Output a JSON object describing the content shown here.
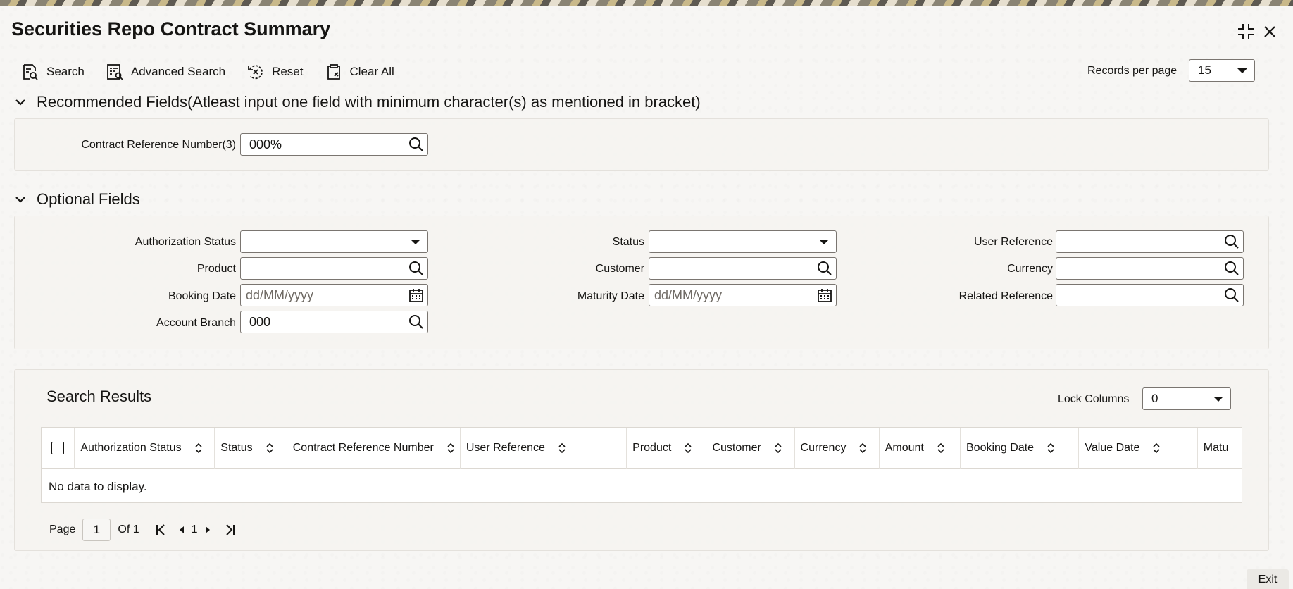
{
  "window": {
    "title": "Securities Repo Contract Summary"
  },
  "toolbar": {
    "search_label": "Search",
    "advanced_search_label": "Advanced Search",
    "reset_label": "Reset",
    "clear_all_label": "Clear All",
    "records_per_page_label": "Records per page",
    "records_per_page_value": "15"
  },
  "recommended": {
    "heading": "Recommended Fields(Atleast input one field with minimum character(s) as mentioned in bracket)",
    "contract_ref_label": "Contract Reference Number(3)",
    "contract_ref_value": "000%"
  },
  "optional": {
    "heading": "Optional Fields",
    "authorization_status_label": "Authorization Status",
    "authorization_status_value": "",
    "product_label": "Product",
    "product_value": "",
    "booking_date_label": "Booking Date",
    "booking_date_placeholder": "dd/MM/yyyy",
    "account_branch_label": "Account Branch",
    "account_branch_value": "000",
    "status_label": "Status",
    "status_value": "",
    "customer_label": "Customer",
    "customer_value": "",
    "maturity_date_label": "Maturity Date",
    "maturity_date_placeholder": "dd/MM/yyyy",
    "user_reference_label": "User Reference",
    "user_reference_value": "",
    "currency_label": "Currency",
    "currency_value": "",
    "related_reference_label": "Related Reference",
    "related_reference_value": ""
  },
  "results": {
    "heading": "Search Results",
    "lock_columns_label": "Lock Columns",
    "lock_columns_value": "0",
    "columns": [
      "Authorization Status",
      "Status",
      "Contract Reference Number",
      "User Reference",
      "Product",
      "Customer",
      "Currency",
      "Amount",
      "Booking Date",
      "Value Date",
      "Matu"
    ],
    "empty_message": "No data to display."
  },
  "pager": {
    "page_label": "Page",
    "current_page": "1",
    "of_label": "Of 1",
    "page_number": "1"
  },
  "footer": {
    "exit_label": "Exit"
  }
}
